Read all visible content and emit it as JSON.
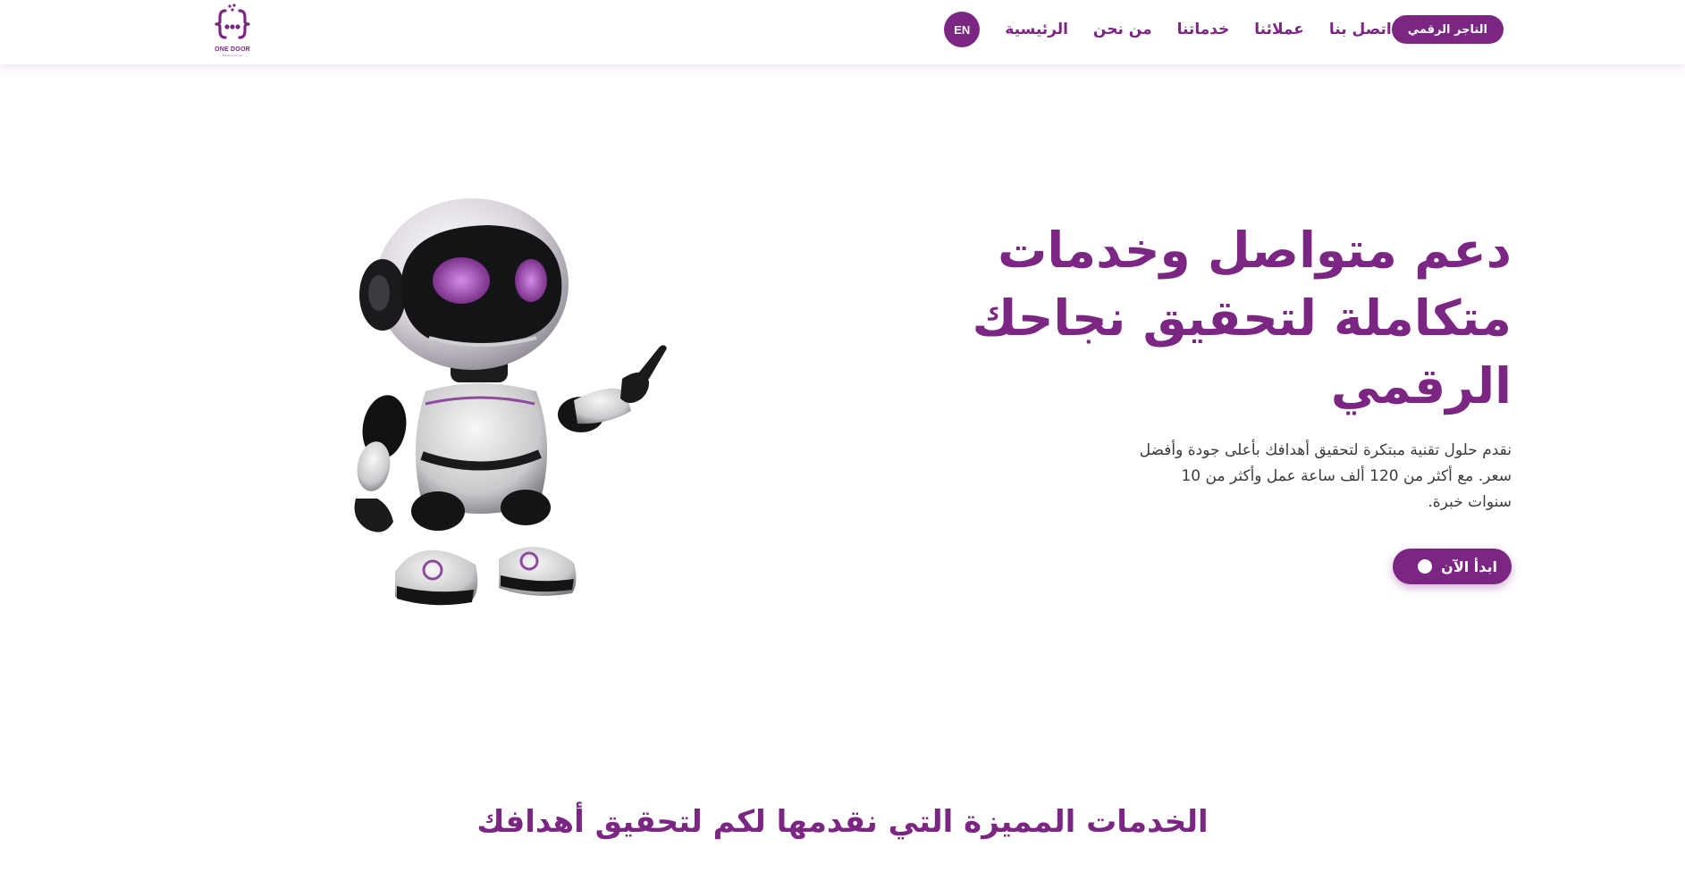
{
  "brand": {
    "logo_text": "ONE DOOR",
    "logo_subtext": "Solutions for you",
    "accent_color": "#7b2682"
  },
  "header": {
    "lang_toggle": "EN",
    "nav": [
      {
        "label": "الرئيسية"
      },
      {
        "label": "من نحن"
      },
      {
        "label": "خدماتنا"
      },
      {
        "label": "عملائنا"
      },
      {
        "label": "اتصل بنا"
      }
    ],
    "merchant_button": "التاجر الرقمي"
  },
  "hero": {
    "title": "دعم متواصل وخدمات\nمتكاملة لتحقيق نجاحك\nالرقمي",
    "description": "نقدم حلول تقنية مبتكرة لتحقيق أهدافك بأعلى جودة وأفضل سعر. مع أكثر من 120 ألف ساعة عمل وأكثر من 10 سنوات خبرة.",
    "cta_label": "ابدأ الآن",
    "illustration": "robot-illustration"
  },
  "services": {
    "title": "الخدمات المميزة التي نقدمها لكم لتحقيق أهدافك"
  }
}
